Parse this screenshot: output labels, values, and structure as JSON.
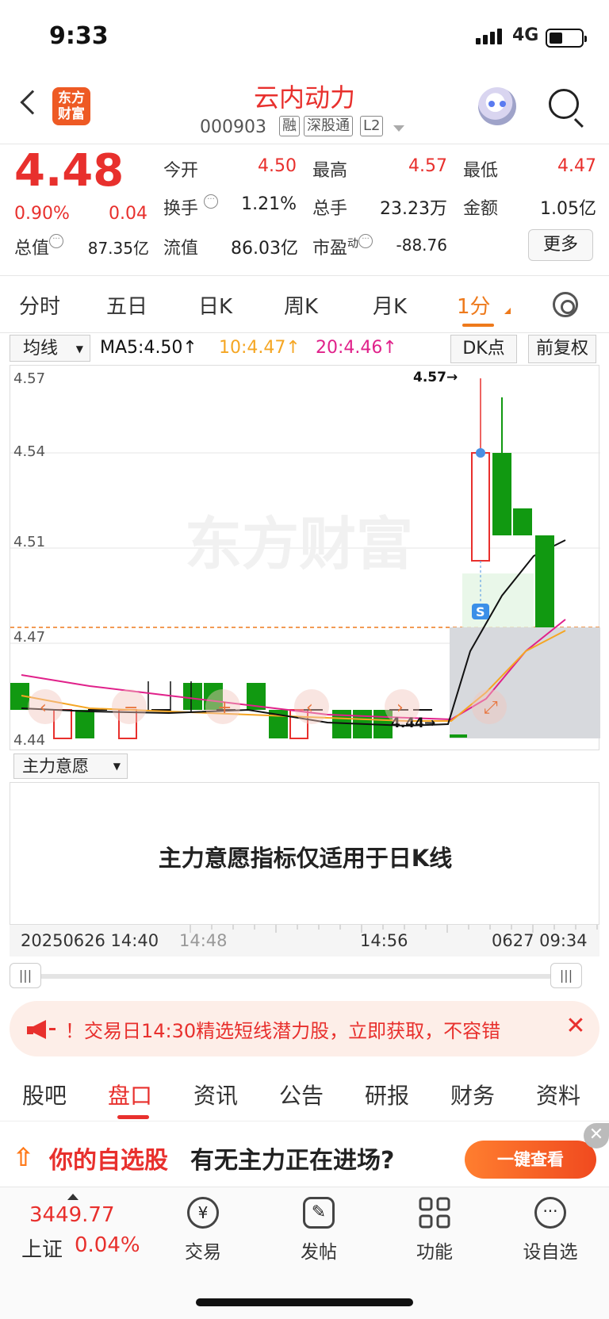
{
  "status": {
    "time": "9:33",
    "network": "4G"
  },
  "header": {
    "title": "云内动力",
    "code": "000903",
    "tags": [
      "融",
      "深股通",
      "L2"
    ],
    "logo": "东方财富"
  },
  "quote": {
    "price": "4.48",
    "change_pct": "0.90%",
    "change": "0.04",
    "fields": [
      {
        "label": "今开",
        "value": "4.50"
      },
      {
        "label": "最高",
        "value": "4.57"
      },
      {
        "label": "最低",
        "value": "4.47"
      },
      {
        "label": "换手",
        "value": "1.21%"
      },
      {
        "label": "总手",
        "value": "23.23万"
      },
      {
        "label": "金额",
        "value": "1.05亿"
      },
      {
        "label": "总值",
        "value": "87.35亿"
      },
      {
        "label": "流值",
        "value": "86.03亿"
      },
      {
        "label": "市盈",
        "value": "-88.76"
      }
    ],
    "pe_sup": "动",
    "more": "更多"
  },
  "tabs": [
    "分时",
    "五日",
    "日K",
    "周K",
    "月K",
    "1分"
  ],
  "active_tab": "1分",
  "chart_toolbar": {
    "ma_select": "均线",
    "ma5": "MA5:4.50↑",
    "ma10": "10:4.47↑",
    "ma20": "20:4.46↑",
    "dk": "DK点",
    "fq": "前复权"
  },
  "chart_data": {
    "type": "candlestick",
    "y_ticks": [
      "4.57",
      "4.54",
      "4.51",
      "4.47",
      "4.44"
    ],
    "ylim": [
      4.435,
      4.57
    ],
    "high_label": "4.57→",
    "low_label": "4.44→",
    "watermark": "东方财富",
    "marker": "S",
    "colors": {
      "up": "#e8302d",
      "down": "#119911",
      "ma5": "#111111",
      "ma10": "#f5a623",
      "ma20": "#e0218a",
      "ref": "#ee7a1c"
    },
    "ref_price": 4.44,
    "candles": [
      {
        "x": 0,
        "o": 4.45,
        "c": 4.44,
        "h": 4.45,
        "l": 4.44
      },
      {
        "x": 1,
        "o": 4.44,
        "c": 4.44,
        "h": 4.44,
        "l": 4.44
      },
      {
        "x": 2,
        "o": 4.44,
        "c": 4.44,
        "h": 4.44,
        "l": 4.44
      },
      {
        "x": 3,
        "o": 4.44,
        "c": 4.44,
        "h": 4.44,
        "l": 4.44
      },
      {
        "x": 4,
        "o": 4.44,
        "c": 4.44,
        "h": 4.44,
        "l": 4.44
      }
    ]
  },
  "indicator": {
    "select": "主力意愿",
    "message": "主力意愿指标仅适用于日K线"
  },
  "axis": {
    "labels": [
      "20250626 14:40",
      "14:48",
      "14:56",
      "0627 09:34"
    ]
  },
  "banner": {
    "text": "！交易日14:30精选短线潜力股，立即获取，不容错"
  },
  "bottom_tabs": [
    "股吧",
    "盘口",
    "资讯",
    "公告",
    "研报",
    "财务",
    "资料"
  ],
  "active_bottom": "盘口",
  "promo": {
    "a": "你的自选股",
    "b": "有无主力正在进场?",
    "cta": "一键查看"
  },
  "nav": {
    "index_value": "3449.77",
    "index_name": "上证",
    "index_pct": "0.04%",
    "items": [
      "交易",
      "发帖",
      "功能",
      "设自选"
    ]
  }
}
